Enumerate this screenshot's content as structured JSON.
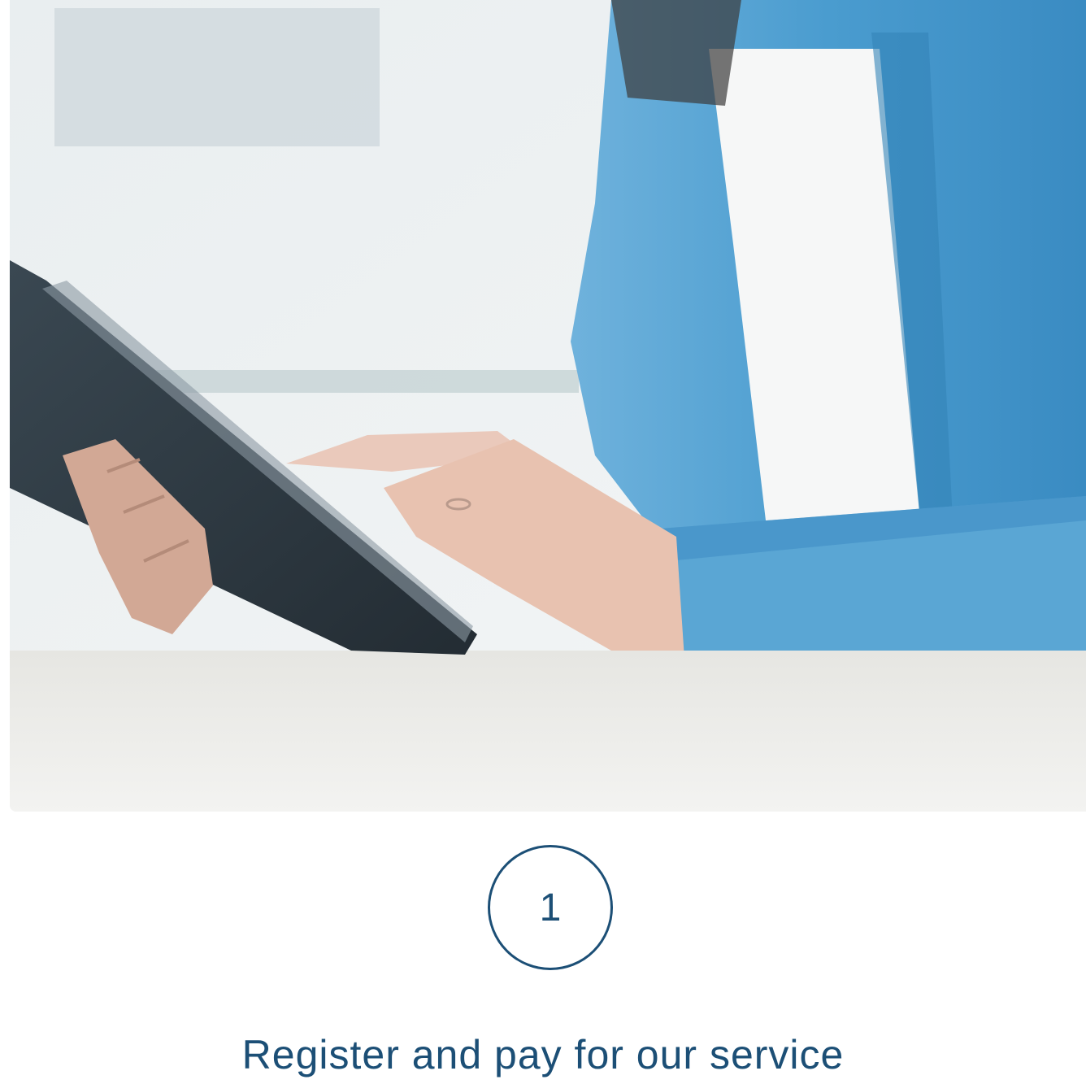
{
  "hero": {
    "image_icon": "photo-person-using-tablet"
  },
  "step": {
    "number": "1",
    "title": "Register and pay for our service"
  },
  "colors": {
    "accent": "#1c4f76",
    "background": "#ffffff"
  }
}
